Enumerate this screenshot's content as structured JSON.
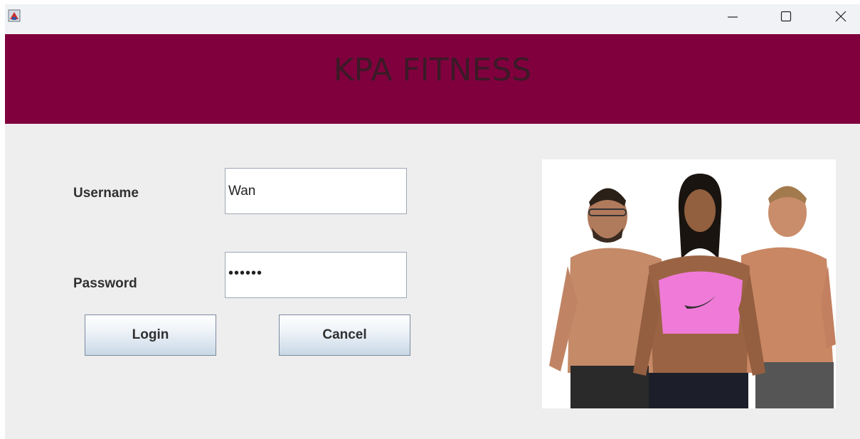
{
  "window": {
    "icon": "java-app-icon",
    "controls": {
      "minimize_icon": "minimize-icon",
      "maximize_icon": "maximize-icon",
      "close_icon": "close-icon"
    }
  },
  "banner": {
    "title": "KPA FITNESS",
    "background": "#80003e",
    "text_color": "#3b1a27"
  },
  "form": {
    "username_label": "Username",
    "username_value": "Wan",
    "password_label": "Password",
    "password_value": "••••••",
    "login_label": "Login",
    "cancel_label": "Cancel"
  },
  "image": {
    "description_icon": "fitness-people-photo"
  }
}
